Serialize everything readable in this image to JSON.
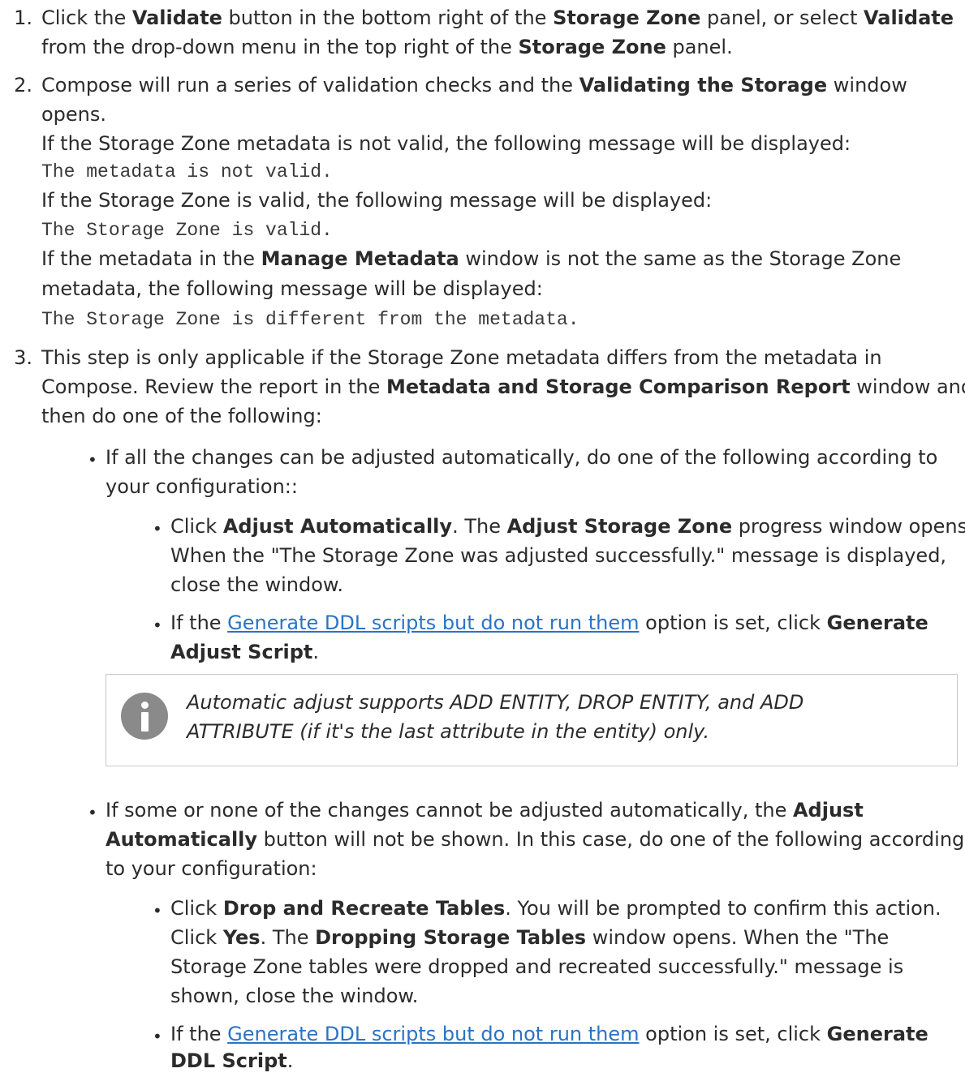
{
  "steps": [
    {
      "number": "1.",
      "line1": {
        "a": "Click the ",
        "b1": "Validate",
        "c": " button in the bottom right of the ",
        "b2": "Storage Zone",
        "d": " panel, or select ",
        "b3": "Validate"
      },
      "line2": {
        "a": "from the drop-down menu in the top right of the ",
        "b": "Storage Zone",
        "c": " panel."
      }
    },
    {
      "number": "2.",
      "line1": {
        "a": "Compose will run a series of validation checks and the ",
        "b": "Validating the Storage",
        "c": " window"
      },
      "line2": "opens.",
      "line3": "If the Storage Zone metadata is not valid, the following message will be displayed:",
      "code1": "The metadata is not valid.",
      "line4": "If the Storage Zone is valid, the following message will be displayed:",
      "code2": "The Storage Zone is valid.",
      "line5": {
        "a": "If the metadata in the ",
        "b": "Manage Metadata",
        "c": " window is not the same as the Storage Zone"
      },
      "line6": "metadata, the following message will be displayed:",
      "code3": "The Storage Zone is different from the metadata."
    },
    {
      "number": "3.",
      "line1": "This step is only applicable if the Storage Zone metadata differs from the metadata in",
      "line2": {
        "a": "Compose. Review the report in the ",
        "b": "Metadata and Storage Comparison Report",
        "c": " window and"
      },
      "line3": "then do one of the following:"
    }
  ],
  "option_a": {
    "line1": "If all the changes can be adjusted automatically, do one of the following according to",
    "line2": "your configuration::",
    "sub1": {
      "line1": {
        "a": "Click ",
        "b1": "Adjust Automatically",
        "c": ". The ",
        "b2": "Adjust Storage Zone",
        "d": " progress window opens."
      },
      "line2": "When the \"The Storage Zone was adjusted successfully.\" message is displayed,",
      "line3": "close the window."
    },
    "sub2": {
      "line1": {
        "a": "If the ",
        "link": "Generate DDL scripts but do not run them",
        "c": " option is set, click ",
        "b": "Generate"
      },
      "line2": {
        "b": "Adjust Script",
        "c": "."
      }
    }
  },
  "note": {
    "icon": "info-icon",
    "line1": "Automatic adjust supports ADD ENTITY, DROP ENTITY, and ADD",
    "line2": "ATTRIBUTE (if it's the last attribute in the entity) only."
  },
  "option_b": {
    "line1": {
      "a": "If some or none of the changes cannot be adjusted automatically, the ",
      "b": "Adjust"
    },
    "line2": {
      "b": "Automatically",
      "c": " button will not be shown. In this case, do one of the following according"
    },
    "line3": "to your configuration:",
    "sub1": {
      "line1": {
        "a": "Click ",
        "b": "Drop and Recreate Tables",
        "c": ". You will be prompted to confirm this action."
      },
      "line2": {
        "a": "Click ",
        "b1": "Yes",
        "c": ". The ",
        "b2": "Dropping Storage Tables",
        "d": " window opens. When the \"The"
      },
      "line3": "Storage Zone tables were dropped and recreated successfully.\" message is",
      "line4": "shown, close the window."
    },
    "sub2": {
      "line1": {
        "a": "If the ",
        "link": "Generate DDL scripts but do not run them",
        "c": " option is set, click ",
        "b": "Generate"
      },
      "line2": {
        "b": "DDL Script",
        "c": "."
      }
    }
  },
  "bullet_char": "•"
}
